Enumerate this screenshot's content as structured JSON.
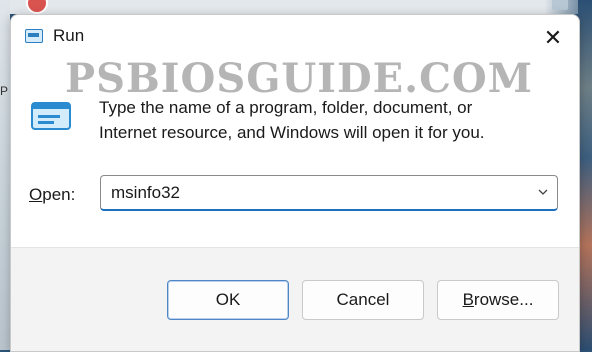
{
  "window": {
    "title": "Run",
    "close_glyph": "✕",
    "icon": "run-icon"
  },
  "watermark": "PSBIOSGUIDE.COM",
  "desktop": {
    "left_letter": "P"
  },
  "description": {
    "line1": "Type the name of a program, folder, document, or",
    "line2": "Internet resource, and Windows will open it for you."
  },
  "open": {
    "label_accel": "O",
    "label_rest": "pen:",
    "value": "msinfo32"
  },
  "buttons": {
    "ok": "OK",
    "cancel": "Cancel",
    "browse_accel": "B",
    "browse_rest": "rowse..."
  },
  "colors": {
    "accent": "#1f6fbf",
    "dialog_bg": "#ffffff",
    "footer_bg": "#f3f3f3"
  }
}
